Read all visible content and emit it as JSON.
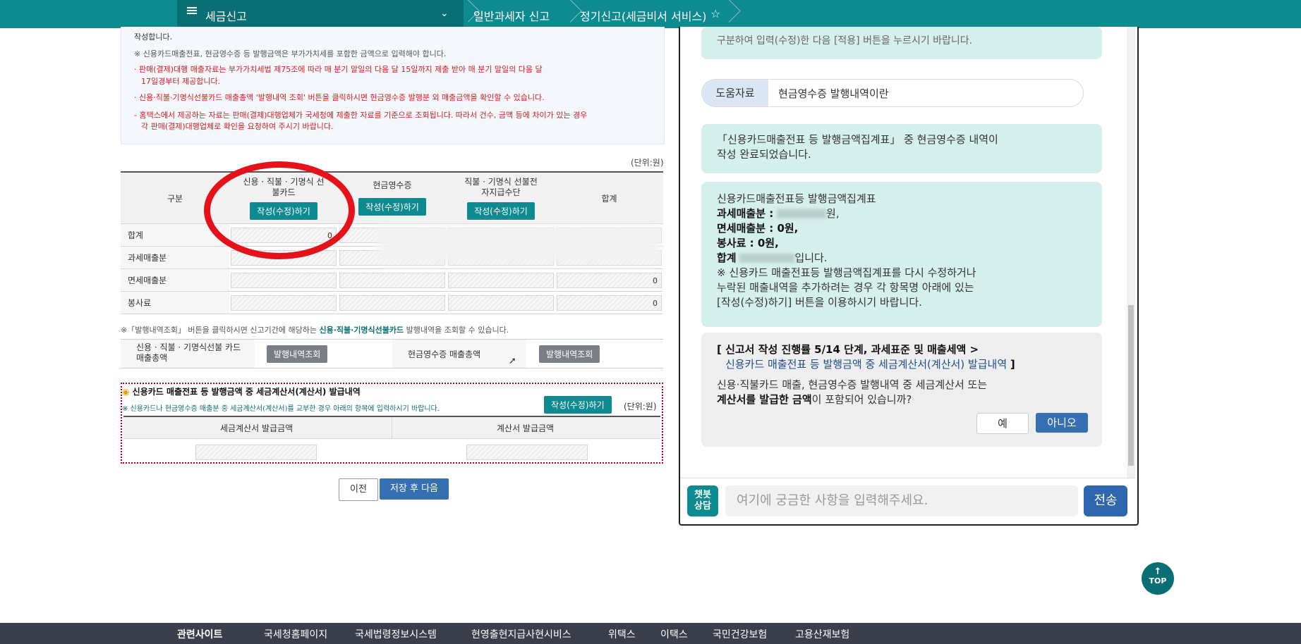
{
  "nav": {
    "menu_title": "세금신고",
    "crumb1": "일반과세자 신고",
    "crumb2": "정기신고(세금비서 서비스)"
  },
  "notice": {
    "line0": "작성합니다.",
    "line1": "※ 신용카드매출전표, 현금영수증 등 발행금액은 부가가치세를 포함한 금액으로 입력해야 합니다.",
    "line2": "· 판매(결제)대행 매출자료는 부가가치세법 제75조에 따라 매 분기 말일의 다음 달 15일까지 제출 받아 매 분기 말일의 다음 달",
    "line3": "17일경부터 제공합니다.",
    "line4": "· 신용·직불·기명식선불카드 매출총액 '발행내역 조회' 버튼을 클릭하시면 현금영수증 발행분 외 매출금액을 확인할 수 있습니다.",
    "line5": "- 홈택스에서 제공하는 자료는 판매(결제)대행업체가 국세청에 제출한 자료를 기준으로 조회됩니다. 따라서 건수, 금액 등에 차이가  있는 경우",
    "line6": "각 판매(결제)대행업체로 확인을 요청하여 주시기 바랍니다."
  },
  "unit_label": "(단위:원)",
  "sales_table": {
    "col_label": "구분",
    "col1": "신용 · 직불 · 기명식 선불카드",
    "col2": "현금영수증",
    "col3": "직불 · 기명식 선불전자지급수단",
    "col4": "합계",
    "edit_button": "작성(수정)하기",
    "rows": [
      {
        "label": "합계",
        "v1": "0",
        "v2": "",
        "v3": "",
        "v4": ""
      },
      {
        "label": "과세매출분",
        "v1": "",
        "v2": "",
        "v3": "",
        "v4": ""
      },
      {
        "label": "면세매출분",
        "v1": "",
        "v2": "",
        "v3": "",
        "v4": "0"
      },
      {
        "label": "봉사료",
        "v1": "",
        "v2": "",
        "v3": "",
        "v4": "0"
      }
    ]
  },
  "hint": {
    "pre": "※「발행내역조회」 버튼을 클릭하시면 신고기간에 해당하는 ",
    "bold": "신용·직불·기명식선불카드",
    "post": " 발행내역을 조회할 수 있습니다."
  },
  "inquiry": {
    "card_total": "신용 · 직불 · 기명식선불 카드 매출총액",
    "inquiry_button": "발행내역조회",
    "cash_total": "현금영수증 매출총액"
  },
  "invoice_box": {
    "title": "신용카드 매출전표 등 발행금액 중 세금계산서(계산서) 발급내역",
    "note": "※ 신용카드나 현금영수증 매출분 중 세금계산서(계산서)를 교부한 경우 아래의 항목에 입력하시기 바랍니다.",
    "edit_button": "작성(수정)하기",
    "unit": "(단위:원)",
    "col1": "세금계산서 발급금액",
    "col2": "계산서 발급금액"
  },
  "buttons": {
    "prev": "이전",
    "save_next": "저장 후 다음"
  },
  "chat": {
    "top_bubble": "구분하여 입력(수정)한 다음 [적용] 버튼을 누르시기 바랍니다.",
    "help_tag": "도움자료",
    "help_text": "현금영수증 발행내역이란",
    "msg1a": "「신용카드매출전표 등 발행금액집계표」 중 현금영수증 내역이",
    "msg1b": "작성 완료되었습니다.",
    "msg2_title": "신용카드매출전표등 발행금액집계표",
    "msg2_taxable": "과세매출분 :",
    "msg2_taxable_suffix": "원,",
    "msg2_exempt": "면세매출분 : 0원,",
    "msg2_service": "봉사료 : 0원,",
    "msg2_total": "합계",
    "msg2_total_suffix": "입니다.",
    "msg2_note1": "※ 신용카드 매출전표등 발행금액집계표를 다시 수정하거나",
    "msg2_note2": "누락된 매출내역을 추가하려는 경우 각 항목명 아래에 있는",
    "msg2_note3": "[작성(수정)하기] 버튼을 이용하시기 바랍니다.",
    "progress_line": "[ 신고서 작성 진행률 5/14 단계, 과세표준 및 매출세액 >",
    "progress_link": "신용카드 매출전표 등 발행금액 중 세금계산서(계산서) 발급내역",
    "progress_end": "]",
    "question1": "신용·직불카드 매출, 현금영수증 발행내역 중 세금계산서 또는",
    "question2a": "계산서를 발급한 금액",
    "question2b": "이 포함되어 있습니까?",
    "yes": "예",
    "no": "아니오",
    "bot_label": "챗봇\n상담",
    "input_placeholder": "여기에 궁금한 사항을 입력해주세요.",
    "send": "전송"
  },
  "top_button": "TOP",
  "footer": {
    "label": "관련사이트",
    "links": [
      "국세청홈페이지",
      "국세법령정보시스템",
      "현영출현지급사현시비스",
      "위택스",
      "이택스",
      "국민건강보험",
      "고용산재보험"
    ]
  }
}
